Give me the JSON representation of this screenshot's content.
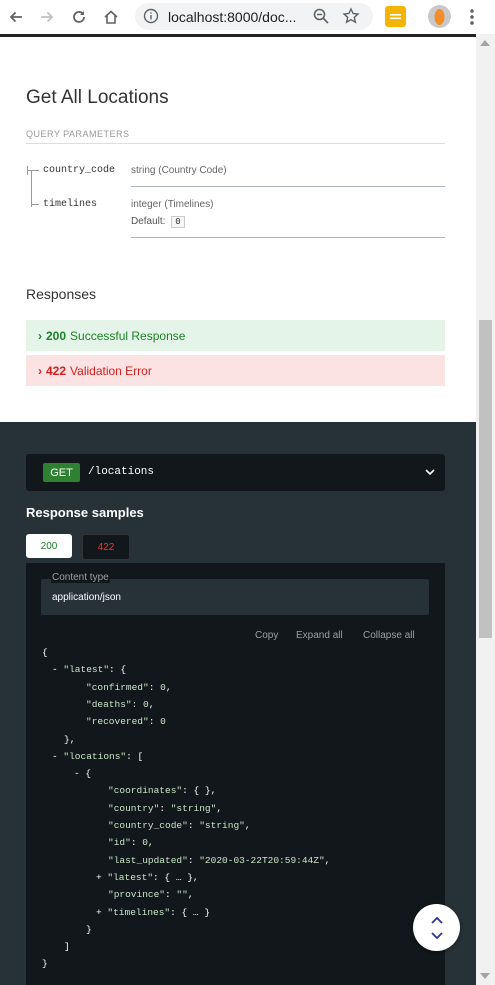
{
  "browser": {
    "url": "localhost:8000/doc...",
    "icons": [
      "back-icon",
      "forward-icon",
      "reload-icon",
      "home-icon",
      "info-icon",
      "zoom-icon",
      "star-icon",
      "extension-icon",
      "avatar",
      "menu-icon"
    ]
  },
  "endpoint": {
    "title": "Get All Locations",
    "query_params_header": "QUERY PARAMETERS",
    "params": [
      {
        "name": "country_code",
        "type": "string",
        "type_desc": "(Country Code)"
      },
      {
        "name": "timelines",
        "type": "integer",
        "type_desc": "(Timelines)",
        "default_label": "Default:",
        "default_value": "0"
      }
    ]
  },
  "responses": {
    "title": "Responses",
    "items": [
      {
        "code": "200",
        "label": "Successful Response",
        "status": "success",
        "color": "#1d8127"
      },
      {
        "code": "422",
        "label": "Validation Error",
        "status": "error",
        "color": "#d41f1c"
      }
    ]
  },
  "operation": {
    "method": "GET",
    "path": "/locations",
    "samples_title": "Response samples",
    "tabs": [
      "200",
      "422"
    ],
    "content_type_label": "Content type",
    "content_type": "application/json",
    "controls": {
      "copy": "Copy",
      "expand": "Expand all",
      "collapse": "Collapse all"
    }
  },
  "json_sample": [
    {
      "indent": 0,
      "text": "{"
    },
    {
      "indent": 1,
      "toggle": "-",
      "key": "\"latest\"",
      "rest": ": {"
    },
    {
      "indent": 2,
      "key": "\"confirmed\"",
      "rest": ": ",
      "value": "0",
      "tail": ","
    },
    {
      "indent": 2,
      "key": "\"deaths\"",
      "rest": ": ",
      "value": "0",
      "tail": ","
    },
    {
      "indent": 2,
      "key": "\"recovered\"",
      "rest": ": ",
      "value": "0"
    },
    {
      "indent": 1,
      "text": "},"
    },
    {
      "indent": 1,
      "toggle": "-",
      "key": "\"locations\"",
      "rest": ": ["
    },
    {
      "indent": 2,
      "toggle": "-",
      "text": "{"
    },
    {
      "indent": 3,
      "key": "\"coordinates\"",
      "rest": ": { },"
    },
    {
      "indent": 3,
      "key": "\"country\"",
      "rest": ": ",
      "value": "\"string\"",
      "tail": ","
    },
    {
      "indent": 3,
      "key": "\"country_code\"",
      "rest": ": ",
      "value": "\"string\"",
      "tail": ","
    },
    {
      "indent": 3,
      "key": "\"id\"",
      "rest": ": ",
      "value": "0",
      "tail": ","
    },
    {
      "indent": 3,
      "key": "\"last_updated\"",
      "rest": ": ",
      "value": "\"2020-03-22T20:59:44Z\"",
      "tail": ","
    },
    {
      "indent": 3,
      "toggle": "+",
      "key": "\"latest\"",
      "rest": ": { … },"
    },
    {
      "indent": 3,
      "key": "\"province\"",
      "rest": ": ",
      "value": "\"\"",
      "tail": ","
    },
    {
      "indent": 3,
      "toggle": "+",
      "key": "\"timelines\"",
      "rest": ": { … }"
    },
    {
      "indent": 2,
      "text": "}"
    },
    {
      "indent": 1,
      "text": "]"
    },
    {
      "indent": 0,
      "text": "}"
    }
  ]
}
